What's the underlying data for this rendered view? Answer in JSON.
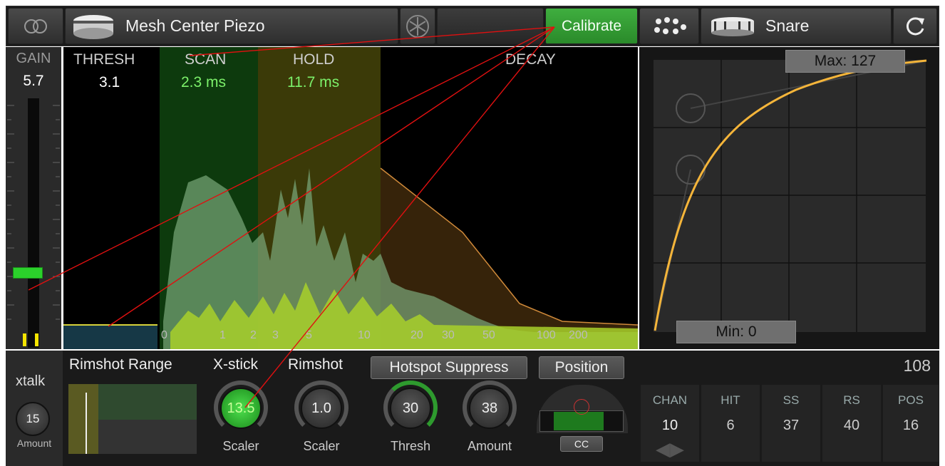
{
  "topbar": {
    "pad_name": "Mesh Center Piezo",
    "calibrate_label": "Calibrate",
    "instrument_name": "Snare"
  },
  "gain": {
    "label": "GAIN",
    "value": "5.7",
    "level": 0.3
  },
  "thresh": {
    "label": "THRESH",
    "value": "3.1"
  },
  "scan": {
    "label": "SCAN",
    "value": "2.3 ms"
  },
  "hold": {
    "label": "HOLD",
    "value": "11.7 ms"
  },
  "decay": {
    "label": "DECAY"
  },
  "scale_ticks": [
    "0",
    "1",
    "2",
    "3",
    "5",
    "10",
    "20",
    "30",
    "50",
    "100",
    "200"
  ],
  "curve": {
    "max_label": "Max: 127",
    "min_label": "Min: 0"
  },
  "xtalk": {
    "label": "xtalk",
    "value": "15",
    "sub": "Amount"
  },
  "rimshot_range": {
    "label": "Rimshot Range"
  },
  "xstick": {
    "label": "X-stick",
    "value": "13.5",
    "sub": "Scaler"
  },
  "rimshot": {
    "label": "Rimshot",
    "value": "1.0",
    "sub": "Scaler"
  },
  "hotspot": {
    "label": "Hotspot Suppress",
    "thresh_value": "30",
    "thresh_sub": "Thresh",
    "amount_value": "38",
    "amount_sub": "Amount"
  },
  "position": {
    "label": "Position",
    "cc_label": "CC"
  },
  "count": "108",
  "channels": [
    {
      "title": "CHAN",
      "value": "10"
    },
    {
      "title": "HIT",
      "value": "6"
    },
    {
      "title": "SS",
      "value": "37"
    },
    {
      "title": "RS",
      "value": "40"
    },
    {
      "title": "POS",
      "value": "16"
    }
  ],
  "colors": {
    "accent_green": "#7cf06a",
    "calibrate": "#3a9e3a",
    "curve": "#f5b53a"
  }
}
